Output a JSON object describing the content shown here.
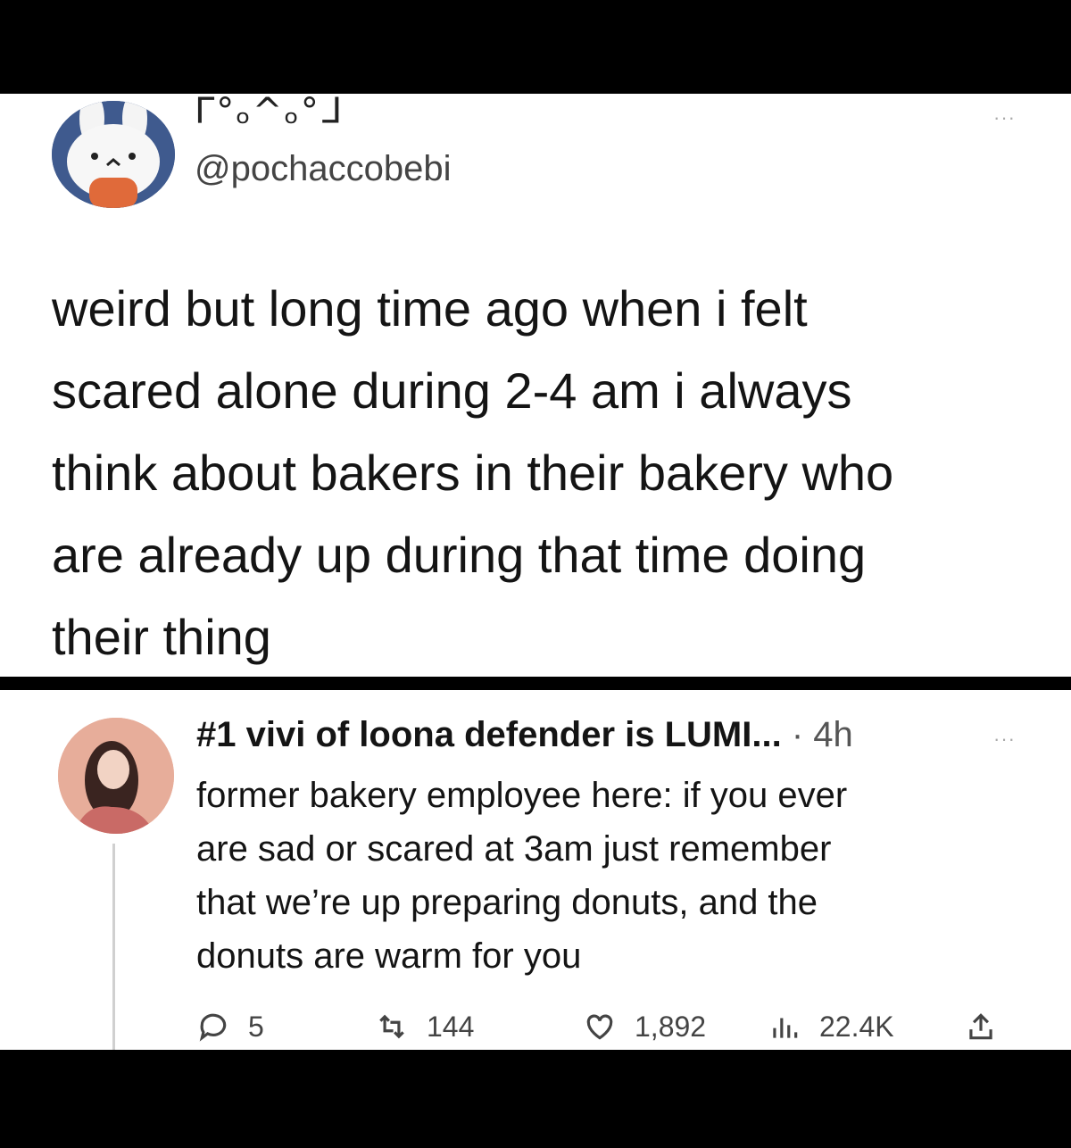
{
  "tweet1": {
    "display_name": "ᒥ°ₒ^ₒ°ᒧ",
    "handle": "@pochaccobebi",
    "more_label": "···",
    "text_lines": [
      "weird but long time ago when i felt",
      "scared alone during 2-4 am i always",
      "think about bakers in their bakery who",
      "are already up during that time doing",
      "their thing"
    ],
    "avatar_icon": "bunny-character-icon"
  },
  "tweet2": {
    "display_name": "#1 vivi of loona defender is LUMI...",
    "time": "· 4h",
    "more_label": "···",
    "text_lines": [
      "former bakery employee here: if you ever",
      "are sad or scared at 3am just remember",
      "that we’re up preparing donuts, and the",
      "donuts are warm for you"
    ],
    "avatar_icon": "profile-photo-icon",
    "actions": {
      "reply_count": "5",
      "retweet_count": "144",
      "like_count": "1,892",
      "views_count": "22.4K"
    }
  },
  "colors": {
    "background_frame": "#000000",
    "panel": "#ffffff",
    "text": "#141414",
    "muted": "#555555"
  }
}
